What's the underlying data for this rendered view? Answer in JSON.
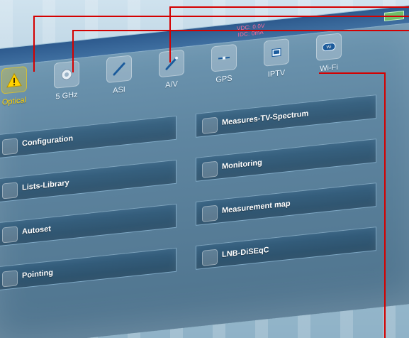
{
  "header": {
    "vdc_line1": "VDC: 0.0V",
    "vdc_line2": "IDC: 0mA"
  },
  "tabs": [
    {
      "label": "Optical",
      "icon": "warning-icon",
      "active": true
    },
    {
      "label": "5 GHz",
      "icon": "satellite-dish-icon",
      "active": false
    },
    {
      "label": "ASI",
      "icon": "cable-icon",
      "active": false
    },
    {
      "label": "A/V",
      "icon": "cable-icon",
      "active": false
    },
    {
      "label": "GPS",
      "icon": "satellite-icon",
      "active": false
    },
    {
      "label": "IPTV",
      "icon": "network-icon",
      "active": false
    },
    {
      "label": "Wi-Fi",
      "icon": "wifi-icon",
      "active": false
    }
  ],
  "menu": {
    "left": [
      {
        "label": "Configuration",
        "icon": "configuration-icon"
      },
      {
        "label": "Lists-Library",
        "icon": "library-icon"
      },
      {
        "label": "Autoset",
        "icon": "autoset-icon"
      },
      {
        "label": "Pointing",
        "icon": "pointing-icon"
      }
    ],
    "right": [
      {
        "label": "Measures-TV-Spectrum",
        "icon": "spectrum-icon"
      },
      {
        "label": "Monitoring",
        "icon": "monitoring-icon"
      },
      {
        "label": "Measurement map",
        "icon": "map-icon"
      },
      {
        "label": "LNB-DiSEqC",
        "icon": "lnb-icon"
      }
    ]
  },
  "colors": {
    "callout": "#d40000",
    "active_tab": "#ffd200",
    "vdc": "#ff6d9a"
  }
}
